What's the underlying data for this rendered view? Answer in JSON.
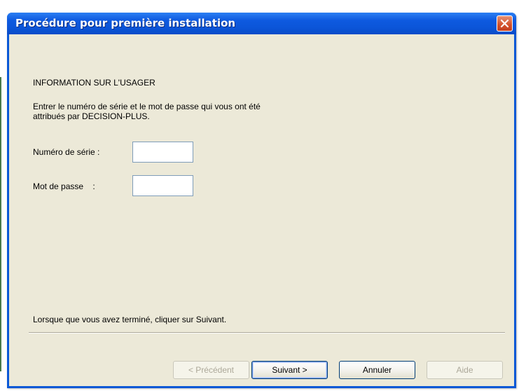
{
  "window": {
    "title": "Procédure pour première installation"
  },
  "content": {
    "heading": "INFORMATION SUR L'USAGER",
    "instructions_line1": "Entrer le numéro de série et le mot de passe qui vous ont été",
    "instructions_line2": "attribués par DECISION-PLUS.",
    "serial_label": "Numéro de série :",
    "serial_value": "",
    "password_label": "Mot de passe    :",
    "password_value": "",
    "footer_text": "Lorsque que vous avez terminé, cliquer sur Suivant."
  },
  "buttons": {
    "previous": "< Précédent",
    "next": "Suivant >",
    "cancel": "Annuler",
    "help": "Aide"
  },
  "icons": {
    "close": "close-icon"
  },
  "colors": {
    "titlebar": "#0b55d8",
    "close_button": "#d2502a",
    "dialog_background": "#ece9d8",
    "field_border": "#7f9db9"
  }
}
